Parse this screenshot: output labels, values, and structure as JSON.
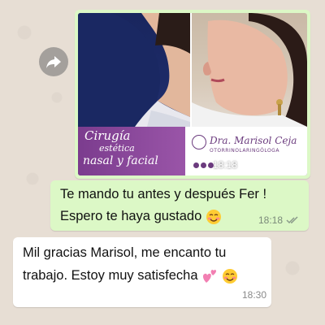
{
  "forward_icon": "forward-arrow-icon",
  "image_message": {
    "banner_title_line1": "Cirugía",
    "banner_title_line2": "estética",
    "banner_title_line3": "nasal y facial",
    "brand_name": "Dra. Marisol Ceja",
    "brand_subtitle": "OTORRINOLARINGÓLOGA",
    "time": "18:18",
    "status_icon": "double-check-icon"
  },
  "outgoing_message": {
    "line1": "Te mando tu antes y después Fer !",
    "line2": "Espero te haya gustado",
    "emoji": "smiling-blush-emoji",
    "time": "18:18",
    "status_icon": "double-check-icon"
  },
  "incoming_message": {
    "line1": "Mil gracias Marisol, me encanto tu",
    "line2": "trabajo. Estoy muy satisfecha",
    "emojis": [
      "pink-hearts-emoji",
      "smiling-blush-emoji"
    ],
    "time": "18:30"
  },
  "colors": {
    "outgoing_bubble": "#dcf8c6",
    "incoming_bubble": "#ffffff",
    "banner_purple": "#7b3c8e",
    "chat_background": "#e7ded4"
  }
}
